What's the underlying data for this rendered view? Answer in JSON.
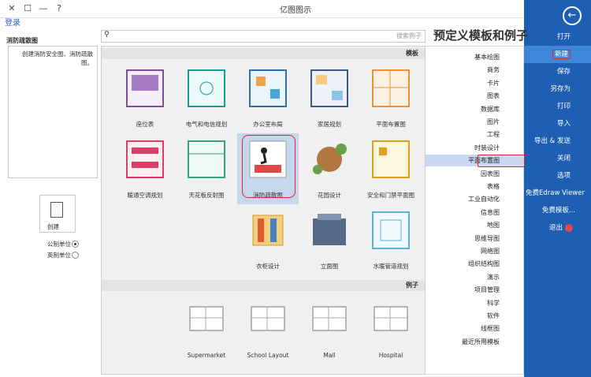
{
  "window": {
    "title": "亿图图示",
    "login": "登录",
    "controls": [
      "✕",
      "☐",
      "—",
      "?"
    ]
  },
  "nav": {
    "back": "←",
    "items": [
      {
        "label": "打开"
      },
      {
        "label": "新建"
      },
      {
        "label": "保存"
      },
      {
        "label": "另存为"
      },
      {
        "label": "打印"
      },
      {
        "label": "导入"
      },
      {
        "label": "导出 & 发送"
      },
      {
        "label": "关闭"
      },
      {
        "label": "选项"
      },
      {
        "label": "免费Edraw Viewer"
      },
      {
        "label": "免费模板..."
      },
      {
        "label": "退出"
      }
    ]
  },
  "heading": "预定义模板和例子",
  "search": {
    "placeholder": "搜索例子",
    "icon": "search-icon"
  },
  "categories": [
    "基本绘图",
    "商务",
    "卡片",
    "图表",
    "数据库",
    "图片",
    "工程",
    "时装设计",
    "平面布置图",
    "因表图",
    "表格",
    "工业自动化",
    "信息图",
    "地图",
    "思维导图",
    "网络图",
    "组织结构图",
    "演示",
    "项目管理",
    "科学",
    "软件",
    "线框图",
    "最近所用模板"
  ],
  "sections": {
    "templates": "模板",
    "examples": "例子"
  },
  "templates": [
    {
      "label": "平面布置图"
    },
    {
      "label": "家居规划"
    },
    {
      "label": "办公室布局"
    },
    {
      "label": "电气和电信规划"
    },
    {
      "label": "座位表"
    },
    {
      "label": "安全和门禁平面图"
    },
    {
      "label": "花园设计"
    },
    {
      "label": "消防疏散图"
    },
    {
      "label": "天花板反射图"
    },
    {
      "label": "暖通空调规划"
    },
    {
      "label": "水暖管道规划"
    },
    {
      "label": "立面图"
    },
    {
      "label": "衣柜设计"
    }
  ],
  "examples": [
    {
      "label": "Hospital"
    },
    {
      "label": "Mall"
    },
    {
      "label": "School Layout"
    },
    {
      "label": "Supermarket"
    }
  ],
  "left_panel": {
    "title": "消防疏散图",
    "description": "创建消防安全图、消防疏散图。",
    "create": "创建",
    "units": [
      "公制单位",
      "英制单位"
    ]
  }
}
